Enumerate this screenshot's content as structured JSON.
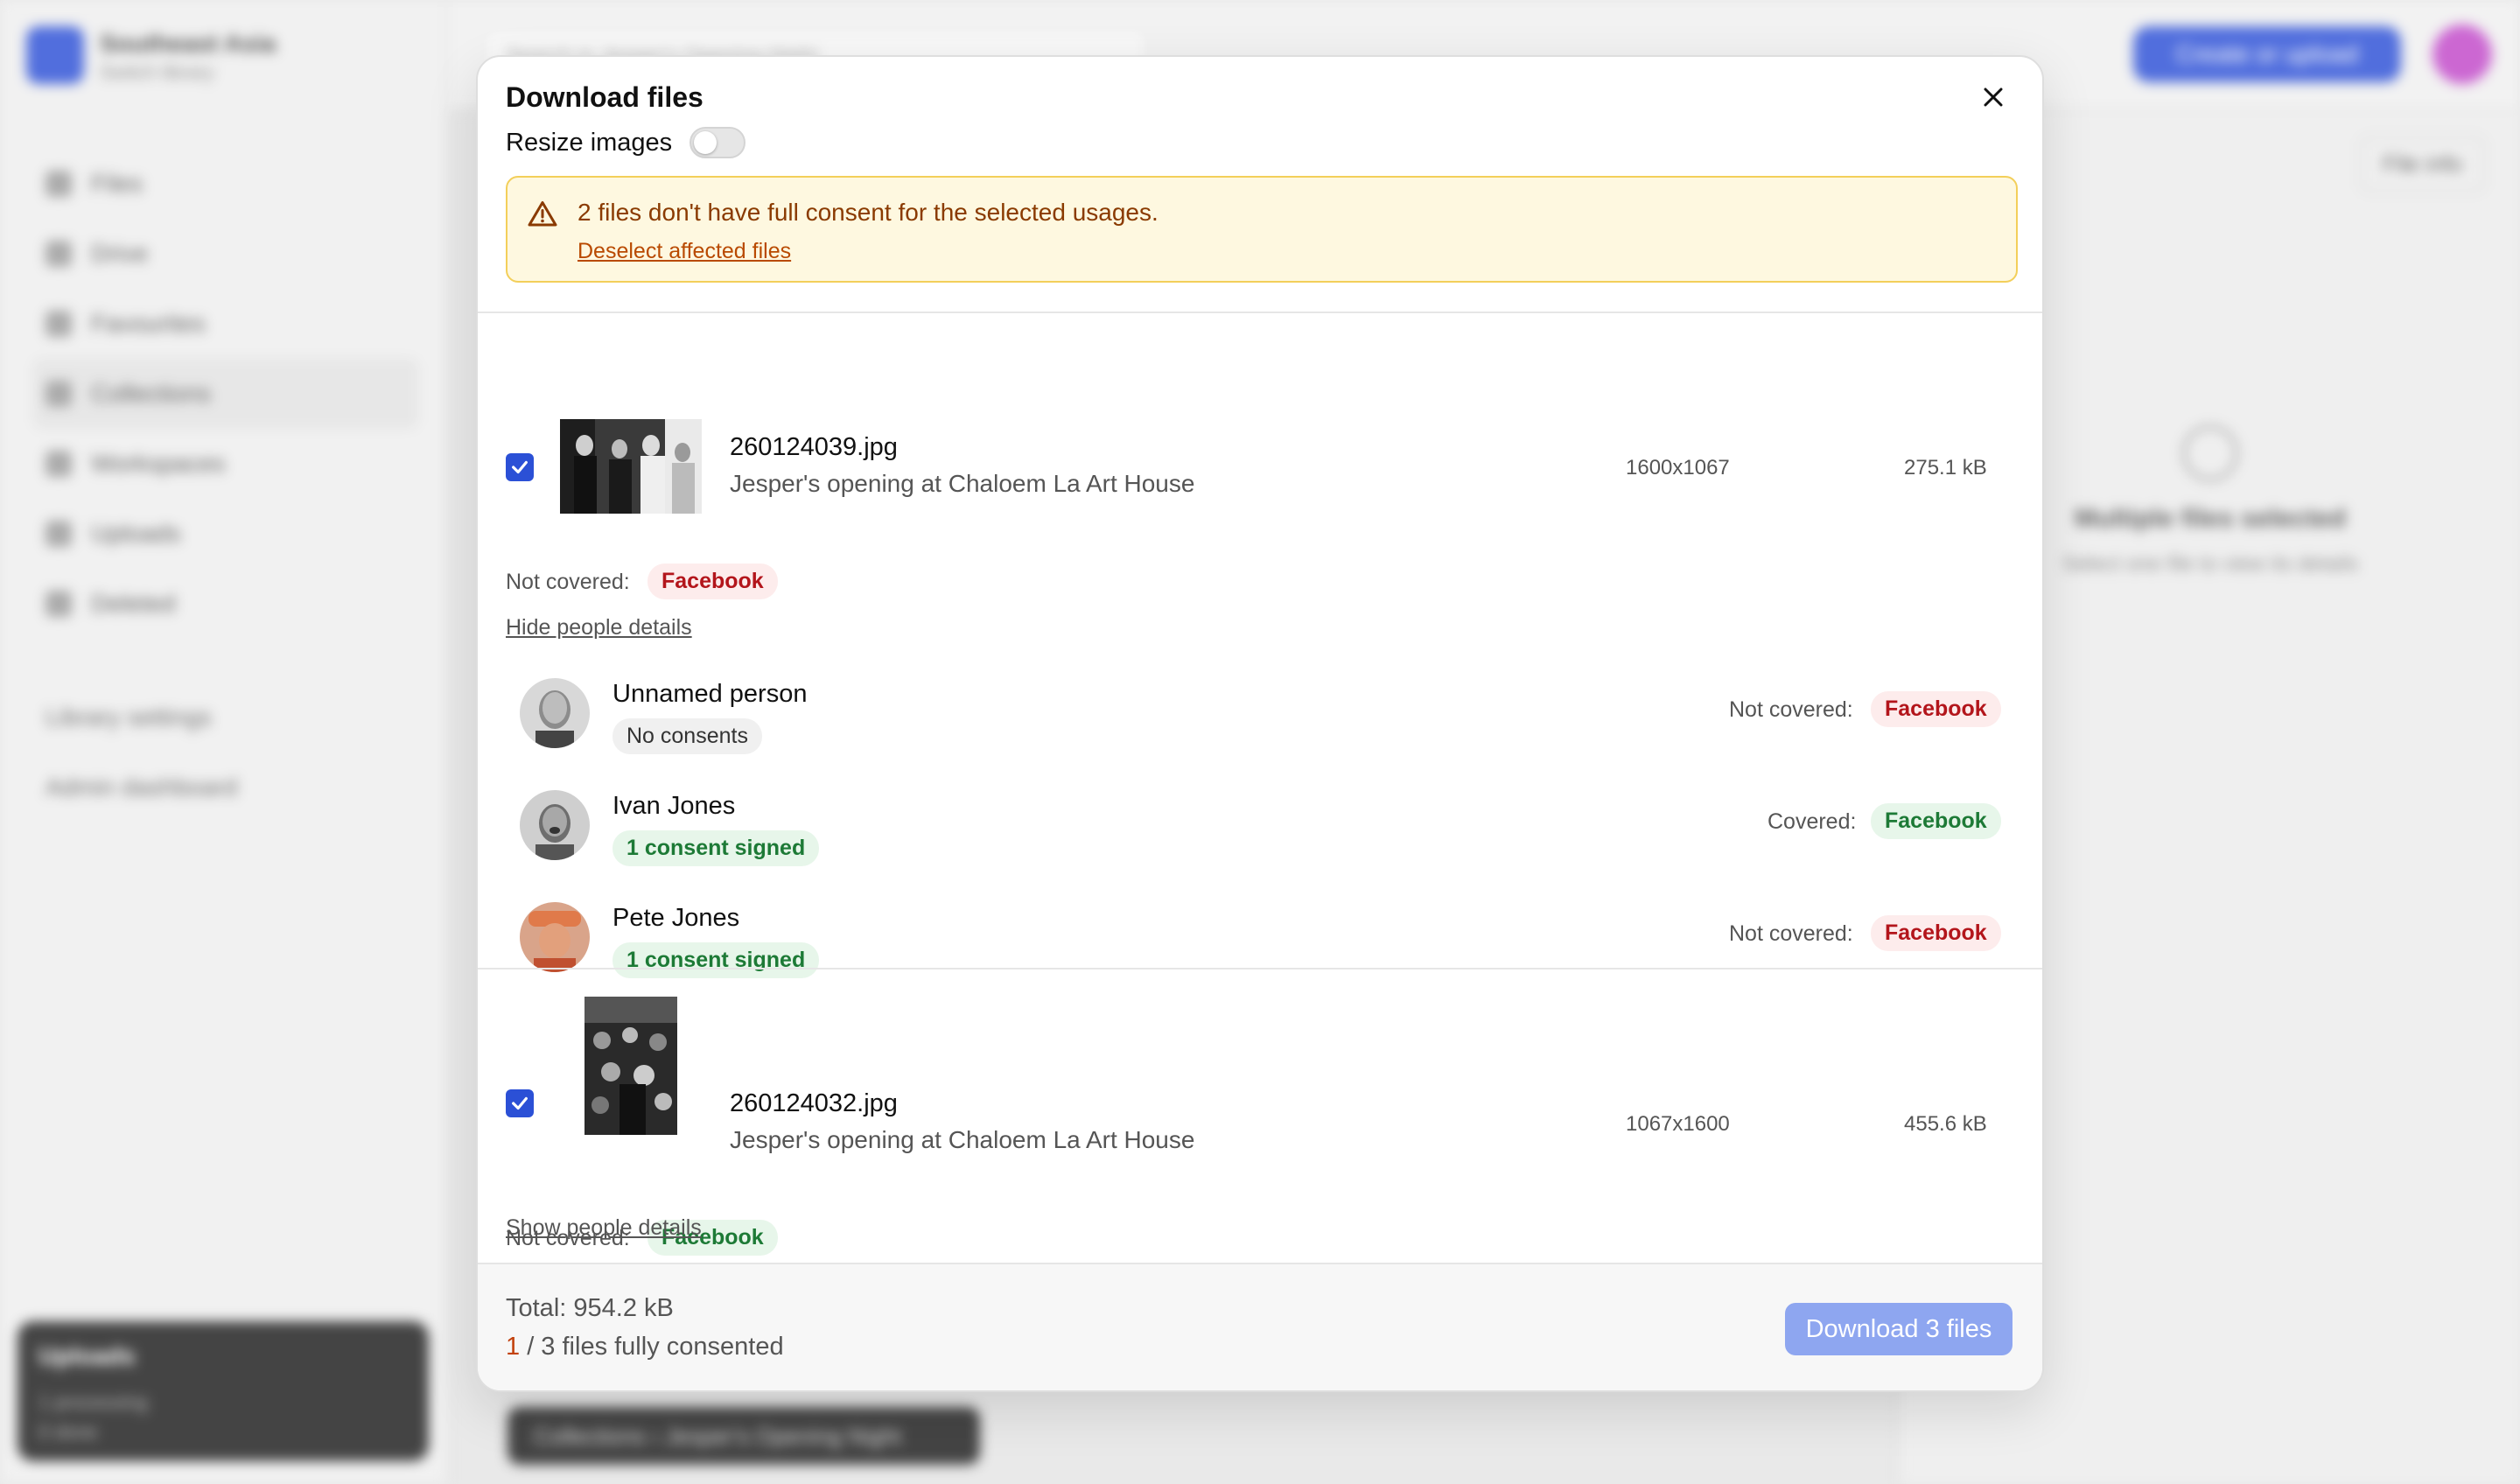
{
  "background": {
    "library_name": "Southeast Asia",
    "library_sub": "Switch library",
    "nav": [
      "Files",
      "Drive",
      "Favourites",
      "Collections",
      "Workspaces",
      "Uploads",
      "Deleted"
    ],
    "settings": [
      "Library settings",
      "Admin dashboard"
    ],
    "search_placeholder": "Search in Jesper's Opening Night",
    "create_button": "Create or upload",
    "file_info": "File info",
    "multi_title": "Multiple files selected",
    "multi_sub": "Select one file to view its details",
    "uploads_title": "Uploads",
    "uploads_line1": "1 processing",
    "uploads_line2": "0 done",
    "breadcrumb": "Collections  ›  Jesper's Opening Night"
  },
  "modal": {
    "title": "Download files",
    "resize_label": "Resize images",
    "resize_enabled": false,
    "warning": {
      "text": "2 files don't have full consent for the selected usages.",
      "link": "Deselect affected files"
    },
    "files": [
      {
        "name": "260124039.jpg",
        "description": "Jesper's opening at Chaloem La Art House",
        "dimensions": "1600x1067",
        "size": "275.1 kB",
        "checked": true,
        "coverage_label": "Not covered:",
        "coverage_tag": "Facebook",
        "toggle_link": "Hide people details",
        "people": [
          {
            "name": "Unnamed person",
            "badge": "No consents",
            "coverage_label": "Not covered:",
            "coverage_tag": "Facebook"
          },
          {
            "name": "Ivan Jones",
            "badge": "1 consent signed",
            "coverage_label": "Covered:",
            "coverage_tag": "Facebook"
          },
          {
            "name": "Pete Jones",
            "badge": "1 consent signed",
            "coverage_label": "Not covered:",
            "coverage_tag": "Facebook"
          }
        ]
      },
      {
        "name": "260124032.jpg",
        "description": "Jesper's opening at Chaloem La Art House",
        "dimensions": "1067x1600",
        "size": "455.6 kB",
        "checked": true,
        "coverage_label": "Not covered:",
        "coverage_tag": "Facebook",
        "toggle_link": "Show people details"
      }
    ],
    "footer": {
      "total": "Total: 954.2 kB",
      "consented_count": "1",
      "consented_text": " / 3 files fully consented",
      "download_button": "Download 3 files"
    }
  },
  "colors": {
    "accent": "#2b50d6",
    "warning_bg": "#fef8e0",
    "warning_border": "#f3cf5a",
    "not_covered": "#b3151b",
    "covered": "#1d7a36"
  }
}
